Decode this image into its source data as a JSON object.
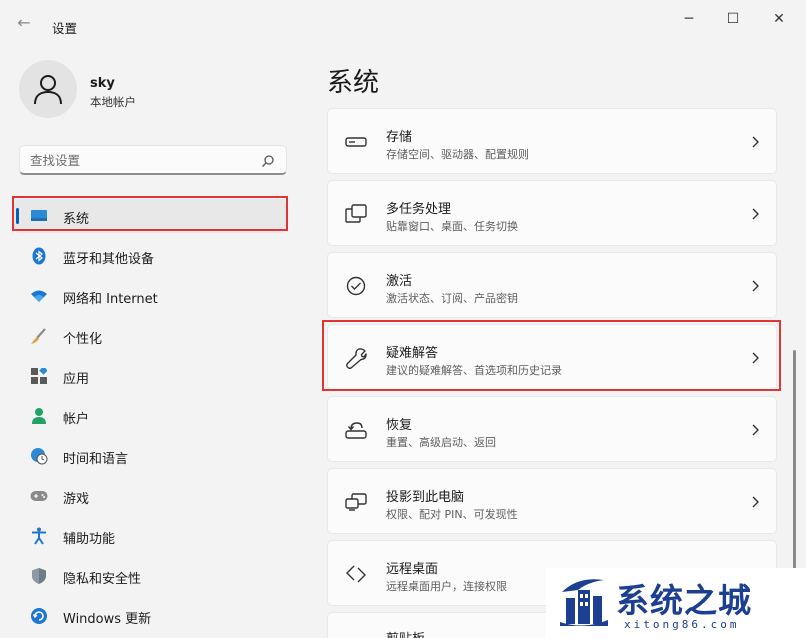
{
  "window": {
    "title": "设置",
    "back": "←",
    "minimize": "─",
    "maximize": "☐",
    "close": "✕"
  },
  "user": {
    "name": "sky",
    "account_type": "本地帐户"
  },
  "search": {
    "placeholder": "查找设置"
  },
  "nav": [
    {
      "label": "系统",
      "icon": "system-icon",
      "selected": true
    },
    {
      "label": "蓝牙和其他设备",
      "icon": "bluetooth-icon"
    },
    {
      "label": "网络和 Internet",
      "icon": "wifi-icon"
    },
    {
      "label": "个性化",
      "icon": "brush-icon"
    },
    {
      "label": "应用",
      "icon": "apps-icon"
    },
    {
      "label": "帐户",
      "icon": "account-icon"
    },
    {
      "label": "时间和语言",
      "icon": "time-language-icon"
    },
    {
      "label": "游戏",
      "icon": "gamepad-icon"
    },
    {
      "label": "辅助功能",
      "icon": "accessibility-icon"
    },
    {
      "label": "隐私和安全性",
      "icon": "shield-icon"
    },
    {
      "label": "Windows 更新",
      "icon": "update-icon"
    }
  ],
  "main": {
    "title": "系统",
    "cards": [
      {
        "title": "存储",
        "subtitle": "存储空间、驱动器、配置规则",
        "icon": "storage-icon"
      },
      {
        "title": "多任务处理",
        "subtitle": "贴靠窗口、桌面、任务切换",
        "icon": "multitasking-icon"
      },
      {
        "title": "激活",
        "subtitle": "激活状态、订阅、产品密钥",
        "icon": "activation-icon"
      },
      {
        "title": "疑难解答",
        "subtitle": "建议的疑难解答、首选项和历史记录",
        "icon": "wrench-icon"
      },
      {
        "title": "恢复",
        "subtitle": "重置、高级启动、返回",
        "icon": "recovery-icon"
      },
      {
        "title": "投影到此电脑",
        "subtitle": "权限、配对 PIN、可发现性",
        "icon": "projection-icon"
      },
      {
        "title": "远程桌面",
        "subtitle": "远程桌面用户，连接权限",
        "icon": "remote-desktop-icon"
      },
      {
        "title": "剪贴板",
        "subtitle": "",
        "icon": "clipboard-icon"
      }
    ]
  },
  "watermark": {
    "text": "系统之城",
    "url": "xitong86.com"
  },
  "colors": {
    "accent": "#005fb8",
    "highlight": "#e03535",
    "watermark": "#1c3f92"
  }
}
